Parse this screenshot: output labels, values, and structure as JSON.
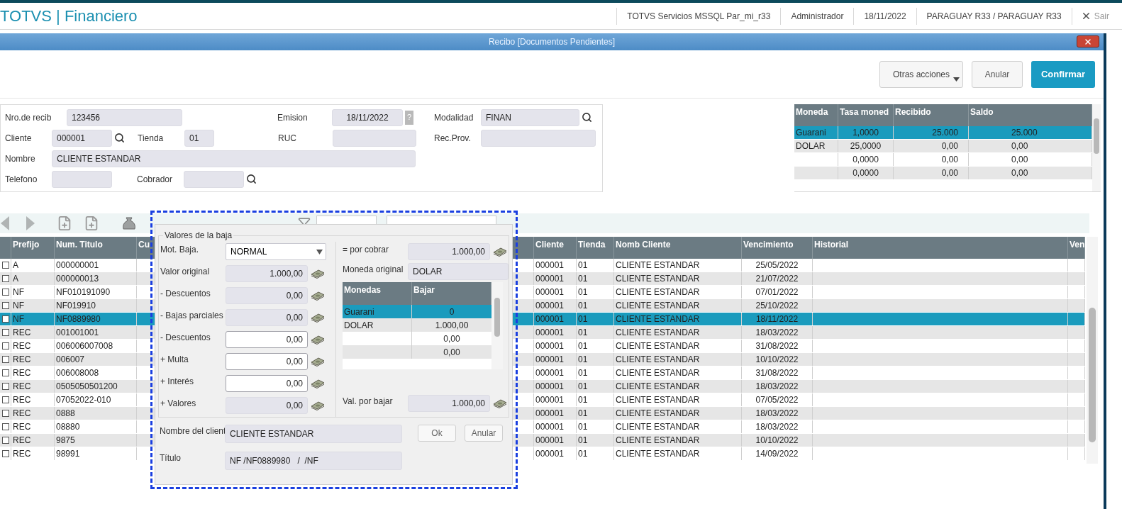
{
  "app": {
    "title": "TOTVS | Financiero",
    "status": [
      "TOTVS Servicios MSSQL Par_mi_r33",
      "Administrador",
      "18/11/2022",
      "PARAGUAY R33 / PARAGUAY R33"
    ],
    "exit": "Sair"
  },
  "window": {
    "title": "Recibo [Documentos Pendientes]",
    "actions": [
      {
        "label": "Otras acciones",
        "kind": "menu"
      },
      {
        "label": "Anular",
        "kind": "default"
      },
      {
        "label": "Confirmar",
        "kind": "primary"
      }
    ]
  },
  "form": {
    "fields": [
      {
        "label": "Nro.de recib",
        "value": "123456"
      },
      {
        "label": "Emision",
        "value": "18/11/2022",
        "help": "?"
      },
      {
        "label": "Modalidad",
        "value": "FINAN",
        "lookup": true
      },
      {
        "label": "Cliente",
        "value": "000001",
        "lookup": true
      },
      {
        "label": "Tienda",
        "value": "01"
      },
      {
        "label": "RUC"
      },
      {
        "label": "Rec.Prov."
      },
      {
        "label": "Nombre",
        "value": "CLIENTE ESTANDAR"
      },
      {
        "label": "Telefono"
      },
      {
        "label": "Cobrador",
        "lookup": true
      }
    ]
  },
  "currency": {
    "columns": [
      "Moneda",
      "Tasa moned",
      "Recibido",
      "Saldo"
    ],
    "rows": [
      {
        "moneda": "Guarani",
        "tasa": "1,0000",
        "recibido": "25.000",
        "saldo": "25.000",
        "selected": true
      },
      {
        "moneda": "DOLAR",
        "tasa": "25,0000",
        "recibido": "0,00",
        "saldo": "0,00",
        "selected": false
      },
      {
        "tasa": "0,0000",
        "recibido": "0,00",
        "saldo": "0,00",
        "selected": false
      },
      {
        "tasa": "0,0000",
        "recibido": "0,00",
        "saldo": "0,00",
        "selected": false
      }
    ]
  },
  "table": {
    "columns": [
      "Prefijo",
      "Num. Titulo",
      "Cu",
      "Cliente",
      "Tienda",
      "Nomb Cliente",
      "Vencimiento",
      "Historial",
      "Ven"
    ],
    "rows": [
      {
        "checked": false,
        "selected": false,
        "prefijo": "A",
        "num_titulo": "000000001",
        "cliente": "000001",
        "tienda": "01",
        "nomb_cliente": "CLIENTE ESTANDAR",
        "vencimiento": "25/05/2022"
      },
      {
        "checked": false,
        "selected": false,
        "prefijo": "A",
        "num_titulo": "000000013",
        "cliente": "000001",
        "tienda": "01",
        "nomb_cliente": "CLIENTE ESTANDAR",
        "vencimiento": "21/07/2022"
      },
      {
        "checked": false,
        "selected": false,
        "prefijo": "NF",
        "num_titulo": "NF010191090",
        "cliente": "000001",
        "tienda": "01",
        "nomb_cliente": "CLIENTE ESTANDAR",
        "vencimiento": "07/01/2022"
      },
      {
        "checked": false,
        "selected": false,
        "prefijo": "NF",
        "num_titulo": "NF019910",
        "cliente": "000001",
        "tienda": "01",
        "nomb_cliente": "CLIENTE ESTANDAR",
        "vencimiento": "25/10/2022"
      },
      {
        "checked": false,
        "selected": true,
        "prefijo": "NF",
        "num_titulo": "NF0889980",
        "cliente": "000001",
        "tienda": "01",
        "nomb_cliente": "CLIENTE ESTANDAR",
        "vencimiento": "18/11/2022"
      },
      {
        "checked": false,
        "selected": false,
        "prefijo": "REC",
        "num_titulo": "001001001",
        "cliente": "000001",
        "tienda": "01",
        "nomb_cliente": "CLIENTE ESTANDAR",
        "vencimiento": "18/03/2022"
      },
      {
        "checked": false,
        "selected": false,
        "prefijo": "REC",
        "num_titulo": "006006007008",
        "cliente": "000001",
        "tienda": "01",
        "nomb_cliente": "CLIENTE ESTANDAR",
        "vencimiento": "31/08/2022"
      },
      {
        "checked": false,
        "selected": false,
        "prefijo": "REC",
        "num_titulo": "006007",
        "cliente": "000001",
        "tienda": "01",
        "nomb_cliente": "CLIENTE ESTANDAR",
        "vencimiento": "10/10/2022"
      },
      {
        "checked": false,
        "selected": false,
        "prefijo": "REC",
        "num_titulo": "006008008",
        "cliente": "000001",
        "tienda": "01",
        "nomb_cliente": "CLIENTE ESTANDAR",
        "vencimiento": "31/08/2022"
      },
      {
        "checked": false,
        "selected": false,
        "prefijo": "REC",
        "num_titulo": "0505050501200",
        "cliente": "000001",
        "tienda": "01",
        "nomb_cliente": "CLIENTE ESTANDAR",
        "vencimiento": "18/03/2022"
      },
      {
        "checked": false,
        "selected": false,
        "prefijo": "REC",
        "num_titulo": "07052022-010",
        "cliente": "000001",
        "tienda": "01",
        "nomb_cliente": "CLIENTE ESTANDAR",
        "vencimiento": "07/05/2022"
      },
      {
        "checked": false,
        "selected": false,
        "prefijo": "REC",
        "num_titulo": "0888",
        "cliente": "000001",
        "tienda": "01",
        "nomb_cliente": "CLIENTE ESTANDAR",
        "vencimiento": "18/03/2022"
      },
      {
        "checked": false,
        "selected": false,
        "prefijo": "REC",
        "num_titulo": "08880",
        "cliente": "000001",
        "tienda": "01",
        "nomb_cliente": "CLIENTE ESTANDAR",
        "vencimiento": "18/03/2022"
      },
      {
        "checked": false,
        "selected": false,
        "prefijo": "REC",
        "num_titulo": "9875",
        "cliente": "000001",
        "tienda": "01",
        "nomb_cliente": "CLIENTE ESTANDAR",
        "vencimiento": "10/10/2022"
      },
      {
        "checked": false,
        "selected": false,
        "prefijo": "REC",
        "num_titulo": "98991",
        "cliente": "000001",
        "tienda": "01",
        "nomb_cliente": "CLIENTE ESTANDAR",
        "vencimiento": "14/09/2022"
      }
    ]
  },
  "dialog": {
    "group_title": "Valores de la baja",
    "left_fields": [
      {
        "label": "Mot. Baja.",
        "value": "NORMAL",
        "kind": "select",
        "editable": true
      },
      {
        "label": "Valor original",
        "value": "1.000,00",
        "kind": "amount",
        "editable": false
      },
      {
        "label": "- Descuentos",
        "value": "0,00",
        "kind": "amount",
        "editable": false
      },
      {
        "label": "- Bajas parciales",
        "value": "0,00",
        "kind": "amount",
        "editable": false
      },
      {
        "label": "- Descuentos",
        "value": "0,00",
        "kind": "amount",
        "editable": true
      },
      {
        "label": "+ Multa",
        "value": "0,00",
        "kind": "amount",
        "editable": true
      },
      {
        "label": "+ Interés",
        "value": "0,00",
        "kind": "amount",
        "editable": true
      },
      {
        "label": "+ Valores",
        "value": "0,00",
        "kind": "amount",
        "editable": false
      }
    ],
    "right_fields": [
      {
        "label": "= por cobrar",
        "value": "1.000,00",
        "kind": "amount",
        "editable": false
      },
      {
        "label": "Moneda original",
        "value": "DOLAR",
        "kind": "text",
        "editable": false
      }
    ],
    "currency_grid": {
      "columns": [
        "Monedas",
        "Bajar"
      ],
      "rows": [
        {
          "moneda": "Guarani",
          "bajar": "0",
          "selected": true
        },
        {
          "moneda": "DOLAR",
          "bajar": "1.000,00",
          "selected": false
        },
        {
          "bajar": "0,00",
          "selected": false
        },
        {
          "bajar": "0,00",
          "selected": false
        }
      ]
    },
    "val_por_bajar": {
      "label": "Val. por bajar",
      "value": "1.000,00",
      "kind": "amount",
      "editable": false
    },
    "cliente": {
      "label": "Nombre del client",
      "value": "CLIENTE ESTANDAR"
    },
    "titulo": {
      "label": "Título",
      "value": "NF /NF0889980   /  /NF"
    },
    "buttons": [
      "Ok",
      "Anular"
    ]
  }
}
